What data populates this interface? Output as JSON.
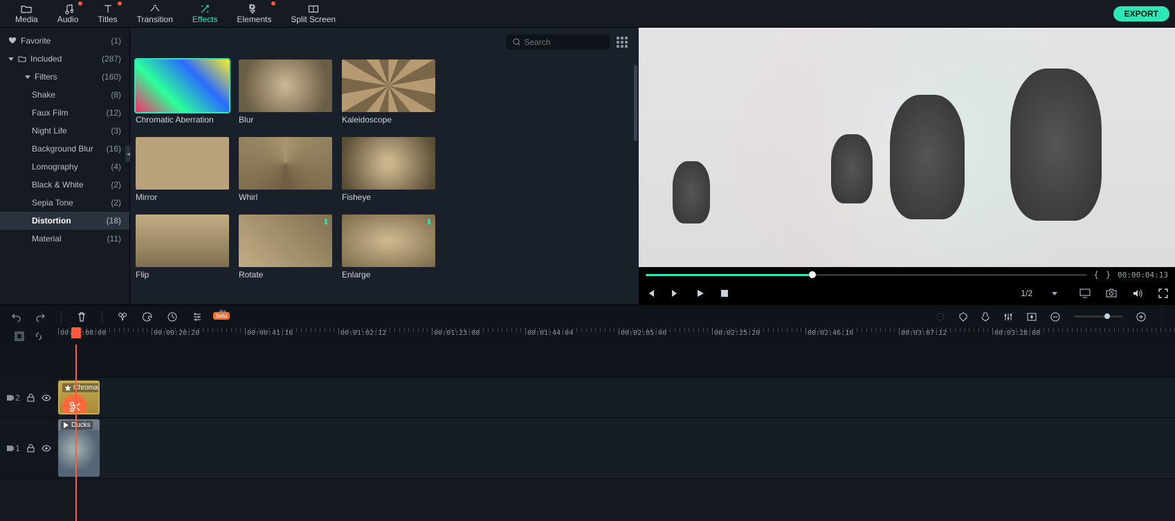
{
  "topnav": {
    "tabs": [
      {
        "label": "Media",
        "icon": "folder-icon",
        "dot": false
      },
      {
        "label": "Audio",
        "icon": "music-icon",
        "dot": true
      },
      {
        "label": "Titles",
        "icon": "text-icon",
        "dot": true
      },
      {
        "label": "Transition",
        "icon": "transition-icon",
        "dot": false
      },
      {
        "label": "Effects",
        "icon": "sparkle-icon",
        "dot": false,
        "active": true
      },
      {
        "label": "Elements",
        "icon": "elements-icon",
        "dot": true
      },
      {
        "label": "Split Screen",
        "icon": "split-icon",
        "dot": false
      }
    ],
    "export_label": "EXPORT"
  },
  "sidebar": {
    "favorite": {
      "label": "Favorite",
      "count": "(1)"
    },
    "included": {
      "label": "Included",
      "count": "(287)"
    },
    "filters": {
      "label": "Filters",
      "count": "(160)"
    },
    "items": [
      {
        "label": "Shake",
        "count": "(8)"
      },
      {
        "label": "Faux Film",
        "count": "(12)"
      },
      {
        "label": "Night Life",
        "count": "(3)"
      },
      {
        "label": "Background Blur",
        "count": "(16)"
      },
      {
        "label": "Lomography",
        "count": "(4)"
      },
      {
        "label": "Black & White",
        "count": "(2)"
      },
      {
        "label": "Sepia Tone",
        "count": "(2)"
      },
      {
        "label": "Distortion",
        "count": "(18)",
        "selected": true
      },
      {
        "label": "Material",
        "count": "(11)"
      }
    ]
  },
  "panel": {
    "search_placeholder": "Search",
    "effects": [
      {
        "label": "Chromatic Aberration",
        "selected": true,
        "bg": "linear-gradient(45deg,#ff2a6a,#2aff9a,#2a6bff,#ffef2a),radial-gradient(#8a6,#463)"
      },
      {
        "label": "Blur",
        "bg": "radial-gradient(circle,#cdb896,#6b5e46 80%)"
      },
      {
        "label": "Kaleidoscope",
        "bg": "repeating-conic-gradient(#b59a72 0 20deg,#7a6648 20deg 40deg)"
      },
      {
        "label": "Mirror",
        "bg": "linear-gradient(90deg,#b9a27c 0 50%,#b9a27c 50% 100%),radial-gradient(#fff3,#0000)"
      },
      {
        "label": "Whirl",
        "bg": "conic-gradient(#a8946e,#6e5e42,#a8946e)"
      },
      {
        "label": "Fisheye",
        "bg": "radial-gradient(circle,#c9b48c 10%,#5a4d36 90%)"
      },
      {
        "label": "Flip",
        "bg": "linear-gradient(#c3ad85,#80704f)",
        "dl": false
      },
      {
        "label": "Rotate",
        "bg": "linear-gradient(45deg,#c3ad85,#80704f)",
        "dl": true
      },
      {
        "label": "Enlarge",
        "bg": "radial-gradient(#d0ba91,#7a6a49)",
        "dl": true
      }
    ]
  },
  "preview": {
    "mark_in": "{",
    "mark_out": "}",
    "timecode": "00:00:04:13",
    "scale_label": "1/2"
  },
  "toolbar": {
    "beta_label": "Beta"
  },
  "ruler": {
    "labels": [
      "00:00:00:00",
      "00:00:20:20",
      "00:00:41:16",
      "00:01:02:12",
      "00:01:23:08",
      "00:01:44:04",
      "00:02:05:00",
      "00:02:25:20",
      "00:02:46:16",
      "00:03:07:12",
      "00:03:28:08"
    ]
  },
  "tracks": {
    "fx": {
      "index_label": "2",
      "clip_label": "Chromati"
    },
    "vid": {
      "index_label": "1",
      "clip_label": "Ducks"
    }
  }
}
